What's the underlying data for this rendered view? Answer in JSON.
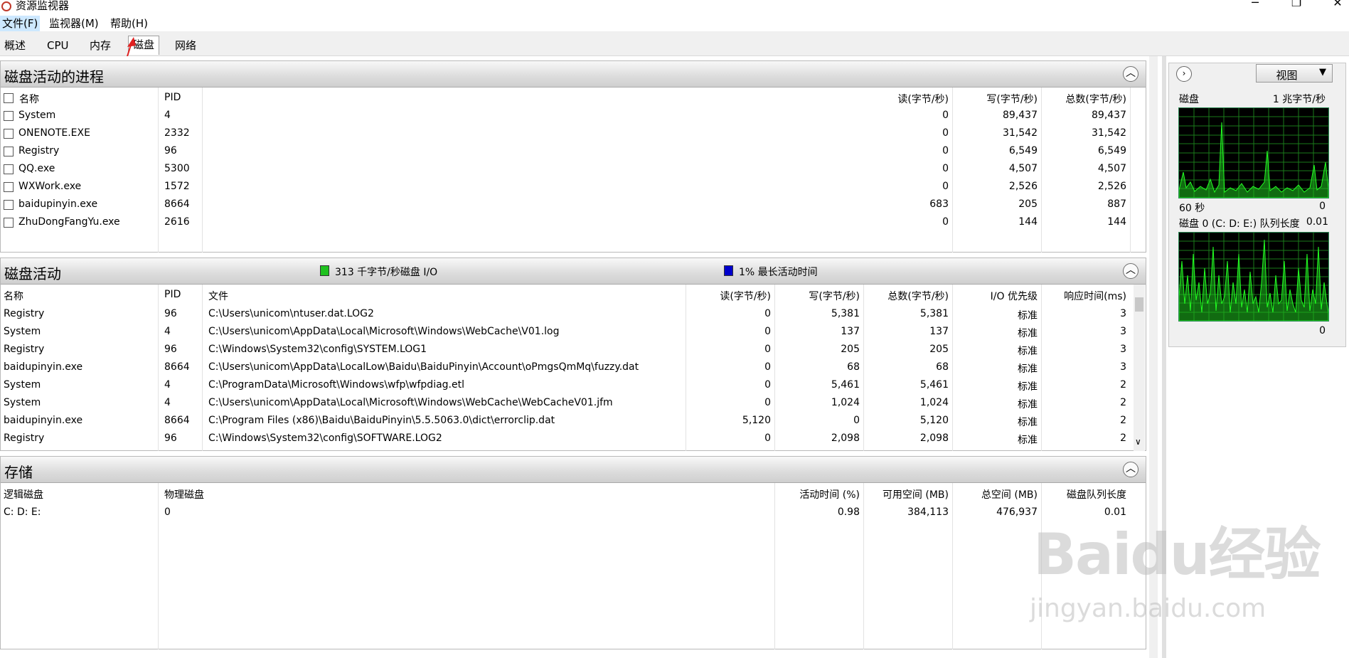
{
  "window": {
    "title": "资源监视器",
    "minimize_icon": "minimize-icon",
    "maximize_icon": "restore-icon",
    "close_icon": "close-icon"
  },
  "menu": [
    "文件(F)",
    "监视器(M)",
    "帮助(H)"
  ],
  "tabs": [
    "概述",
    "CPU",
    "内存",
    "磁盘",
    "网络"
  ],
  "processes_panel": {
    "title": "磁盘活动的进程",
    "columns": [
      "名称",
      "PID",
      "读(字节/秒)",
      "写(字节/秒)",
      "总数(字节/秒)"
    ],
    "rows": [
      [
        "System",
        "4",
        "0",
        "89,437",
        "89,437"
      ],
      [
        "ONENOTE.EXE",
        "2332",
        "0",
        "31,542",
        "31,542"
      ],
      [
        "Registry",
        "96",
        "0",
        "6,549",
        "6,549"
      ],
      [
        "QQ.exe",
        "5300",
        "0",
        "4,507",
        "4,507"
      ],
      [
        "WXWork.exe",
        "1572",
        "0",
        "2,526",
        "2,526"
      ],
      [
        "baidupinyin.exe",
        "8664",
        "683",
        "205",
        "887"
      ],
      [
        "ZhuDongFangYu.exe",
        "2616",
        "0",
        "144",
        "144"
      ]
    ]
  },
  "activity_panel": {
    "title": "磁盘活动",
    "legend_io": "313 千字节/秒磁盘 I/O",
    "legend_active": "1% 最长活动时间",
    "io_color": "#1fc21f",
    "active_color": "#0000cc",
    "columns": [
      "名称",
      "PID",
      "文件",
      "读(字节/秒)",
      "写(字节/秒)",
      "总数(字节/秒)",
      "I/O 优先级",
      "响应时间(ms)"
    ],
    "rows": [
      [
        "Registry",
        "96",
        "C:\\Users\\unicom\\ntuser.dat.LOG2",
        "0",
        "5,381",
        "5,381",
        "标准",
        "3"
      ],
      [
        "System",
        "4",
        "C:\\Users\\unicom\\AppData\\Local\\Microsoft\\Windows\\WebCache\\V01.log",
        "0",
        "137",
        "137",
        "标准",
        "3"
      ],
      [
        "Registry",
        "96",
        "C:\\Windows\\System32\\config\\SYSTEM.LOG1",
        "0",
        "205",
        "205",
        "标准",
        "3"
      ],
      [
        "baidupinyin.exe",
        "8664",
        "C:\\Users\\unicom\\AppData\\LocalLow\\Baidu\\BaiduPinyin\\Account\\oPmgsQmMq\\fuzzy.dat",
        "0",
        "68",
        "68",
        "标准",
        "3"
      ],
      [
        "System",
        "4",
        "C:\\ProgramData\\Microsoft\\Windows\\wfp\\wfpdiag.etl",
        "0",
        "5,461",
        "5,461",
        "标准",
        "2"
      ],
      [
        "System",
        "4",
        "C:\\Users\\unicom\\AppData\\Local\\Microsoft\\Windows\\WebCache\\WebCacheV01.jfm",
        "0",
        "1,024",
        "1,024",
        "标准",
        "2"
      ],
      [
        "baidupinyin.exe",
        "8664",
        "C:\\Program Files (x86)\\Baidu\\BaiduPinyin\\5.5.5063.0\\dict\\errorclip.dat",
        "5,120",
        "0",
        "5,120",
        "标准",
        "2"
      ],
      [
        "Registry",
        "96",
        "C:\\Windows\\System32\\config\\SOFTWARE.LOG2",
        "0",
        "2,098",
        "2,098",
        "标准",
        "2"
      ]
    ]
  },
  "storage_panel": {
    "title": "存储",
    "columns": [
      "逻辑磁盘",
      "物理磁盘",
      "活动时间 (%)",
      "可用空间 (MB)",
      "总空间 (MB)",
      "磁盘队列长度"
    ],
    "rows": [
      [
        "C: D: E:",
        "0",
        "0.98",
        "384,113",
        "476,937",
        "0.01"
      ]
    ]
  },
  "right_pane": {
    "view_label": "视图",
    "graph1": {
      "label": "磁盘",
      "scale": "1 兆字节/秒",
      "time": "60 秒",
      "min": "0"
    },
    "graph2": {
      "label": "磁盘 0 (C: D: E:) 队列长度",
      "scale": "0.01",
      "min": "0"
    }
  },
  "watermark": {
    "logo": "Baidu经验",
    "url": "jingyan.baidu.com"
  }
}
